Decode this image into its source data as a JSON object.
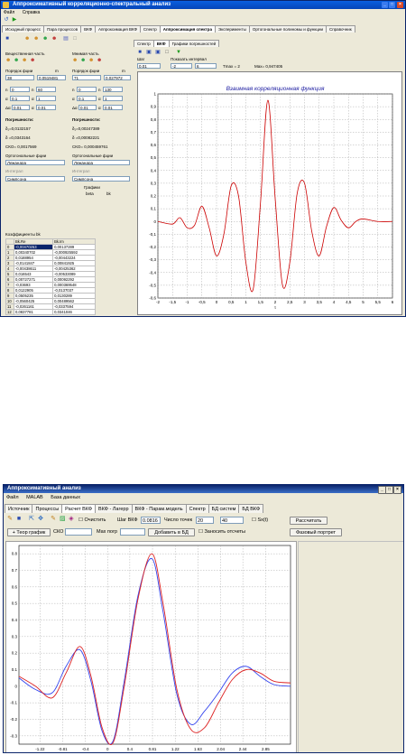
{
  "win1": {
    "title": "Аппроксимативный корреляционно-спектральный анализ",
    "menu": [
      "Файл",
      "Справка"
    ],
    "top_tabs": [
      "Исходный процесс",
      "Пара процессов",
      "ВКФ",
      "Аппроксимация ВКФ",
      "Спектр",
      "Аппроксимация спектра",
      "Эксперименты",
      "Ортогональные полиномы и функции",
      "Справочник"
    ],
    "left": {
      "real_part": "Вещественная часть",
      "imag_part": "Мнимая часть",
      "order_label": "Порядок фции",
      "m_label": "m",
      "order_real": "38",
      "m_real": "0,0519481",
      "order_imag": "71",
      "m_imag": "0,027972",
      "sym_n": "n",
      "sym_a": "α",
      "sym_dalpha": "Δα",
      "sym_alpha": "α",
      "real_n_min": "0",
      "real_n_max": "60",
      "real_a_min": "0,1",
      "real_a_max": "1",
      "real_da": "0,01",
      "real_e": "0,01",
      "imag_n_min": "0",
      "imag_n_max": "130",
      "imag_a_min": "0,1",
      "imag_a_max": "1",
      "imag_da": "0,01",
      "imag_e": "0,01",
      "errors_label": "Погрешности:",
      "real_d1": "δ₁=0,0132157",
      "real_d": "δ =0,0343164",
      "real_sko": "СКО= 0,0017569",
      "imag_d1": "δ₁=0,00247389",
      "imag_d": "δ =0,00082221",
      "imag_sko": "СКО= 0,000459761",
      "orth_label": "Ортогональные фции",
      "orth_value": "Лежандра",
      "integral_label": "Интеграл",
      "method_value": "Симпсона",
      "graphs_label": "Графики",
      "beta_label": "beta",
      "bk_label": "bk",
      "coef_title": "Коэффициенты bk",
      "col1": "Bk.Re",
      "col2": "Bk.Im",
      "rows": [
        [
          "0",
          "-0,00470253",
          "0,00137289"
        ],
        [
          "1",
          "0,00340702",
          "-0,000925592"
        ],
        [
          "2",
          "0,0188954",
          "-0,00443224"
        ],
        [
          "3",
          "-0,0141847",
          "0,00841925"
        ],
        [
          "4",
          "-0,00438611",
          "-0,00425362"
        ],
        [
          "5",
          "0,016543",
          "-0,00533089"
        ],
        [
          "6",
          "0,00727271",
          "0,00092292"
        ],
        [
          "7",
          "-0,03693",
          "0,000369548"
        ],
        [
          "8",
          "0,0122905",
          "-0,0137037"
        ],
        [
          "9",
          "0,0505235",
          "0,0130289"
        ],
        [
          "10",
          "-0,0560425",
          "0,00489562"
        ],
        [
          "11",
          "-0,0261161",
          "-0,0337594"
        ],
        [
          "12",
          "0,0837781",
          "0,0341046"
        ]
      ]
    },
    "right": {
      "tabs": [
        "Спектр",
        "ВКФ",
        "Графики погрешностей"
      ],
      "step_label": "Шаг",
      "step_value": "0,01",
      "interval_label": "Показать интервал",
      "interval_from": "-2",
      "interval_to": "6",
      "tmax": "Tmax = 2",
      "max": "Max= 0,947405",
      "chart_title": "Взаимная корреляционная функция",
      "xlabel": "τ"
    }
  },
  "win2": {
    "title": "Аппроксимативный анализ",
    "menu": [
      "Файл",
      "MALAB",
      "База данных"
    ],
    "tabs": [
      "Источник",
      "Процессы",
      "Расчет ВКФ",
      "ВКФ - Лагерр",
      "ВКФ - Парам.модель",
      "Спектр",
      "БД систем",
      "БД ВКФ"
    ],
    "clear_label": "Очистить",
    "step_label": "Шаг ВКФ",
    "step_value": "0.0816",
    "points_label": "Число точек",
    "points_value": "20",
    "points_value2": "40",
    "sx_label": "Sx(t)",
    "calc_button": "Рассчитать",
    "theory_button": "+ Теор график",
    "sko_label": "СКО",
    "max_err_label": "Max погр",
    "add_db_button": "Добавить в БД",
    "record_label": "Заносить отсчеты",
    "phase_button": "Фазовый портрет"
  },
  "chart_data": [
    {
      "type": "line",
      "title": "Взаимная корреляционная функция",
      "xlabel": "τ",
      "ylabel": "",
      "xlim": [
        -2,
        6
      ],
      "ylim": [
        -0.6,
        1
      ],
      "grid": true,
      "x_ticks": [
        "-2",
        "-1,5",
        "-1",
        "-0,5",
        "0",
        "0,5",
        "1",
        "1,5",
        "2",
        "2,5",
        "3",
        "3,5",
        "4",
        "4,5",
        "5",
        "5,5",
        "6"
      ],
      "y_ticks": [
        "1",
        "0,9",
        "0,8",
        "0,7",
        "0,6",
        "0,5",
        "0,4",
        "0,3",
        "0,2",
        "0,1",
        "0",
        "-0,1",
        "-0,2",
        "-0,3",
        "-0,4",
        "-0,5",
        "-0,6"
      ],
      "series": [
        {
          "color": "#cc0000",
          "x": [
            -2,
            -1.5,
            -1.25,
            -1,
            -0.75,
            -0.5,
            -0.25,
            0,
            0.25,
            0.5,
            0.75,
            1,
            1.25,
            1.5,
            1.75,
            2,
            2.25,
            2.5,
            2.75,
            3,
            3.25,
            3.5,
            3.75,
            4,
            4.25,
            4.5,
            4.75,
            5,
            5.5,
            6
          ],
          "y": [
            0.0,
            -0.02,
            0.03,
            -0.05,
            -0.03,
            0.12,
            -0.05,
            -0.27,
            -0.1,
            0.28,
            0.2,
            -0.32,
            -0.53,
            0.15,
            0.95,
            0.18,
            -0.5,
            -0.32,
            0.22,
            0.3,
            -0.08,
            -0.27,
            -0.04,
            0.11,
            0.01,
            -0.05,
            0.0,
            0.02,
            0.0,
            0.0
          ]
        }
      ]
    },
    {
      "type": "line",
      "title": "",
      "xlabel": "",
      "ylabel": "",
      "xlim": [
        -1.6,
        3.3
      ],
      "ylim": [
        -0.35,
        0.85
      ],
      "grid": true,
      "x_ticks": [
        "-1.22",
        "-0.81",
        "-0.4",
        "0",
        "0.4",
        "0.81",
        "1.22",
        "1.63",
        "2.04",
        "2.44",
        "2.85"
      ],
      "y_ticks": [
        "0.8",
        "0.7",
        "0.6",
        "0.5",
        "0.4",
        "0.3",
        "0.2",
        "0.1",
        "0",
        "-0.1",
        "-0.2",
        "-0.3"
      ],
      "series": [
        {
          "color": "#3344ee",
          "x": [
            -1.6,
            -1.3,
            -1.0,
            -0.75,
            -0.5,
            -0.3,
            -0.1,
            0.1,
            0.3,
            0.55,
            0.8,
            1.0,
            1.25,
            1.5,
            1.75,
            2.0,
            2.25,
            2.5,
            2.75,
            3.0,
            3.3
          ],
          "y": [
            0.05,
            -0.02,
            -0.04,
            0.12,
            0.22,
            0.03,
            -0.27,
            -0.33,
            0.03,
            0.55,
            0.77,
            0.45,
            -0.05,
            -0.23,
            -0.15,
            -0.04,
            0.08,
            0.12,
            0.06,
            0.01,
            0.0
          ]
        },
        {
          "color": "#dd2222",
          "x": [
            -1.6,
            -1.3,
            -1.0,
            -0.75,
            -0.5,
            -0.3,
            -0.1,
            0.1,
            0.3,
            0.55,
            0.8,
            1.0,
            1.25,
            1.5,
            1.75,
            2.0,
            2.25,
            2.5,
            2.75,
            3.0,
            3.3
          ],
          "y": [
            0.06,
            0.0,
            -0.07,
            0.08,
            0.24,
            0.06,
            -0.25,
            -0.34,
            0.0,
            0.53,
            0.8,
            0.5,
            -0.02,
            -0.26,
            -0.25,
            -0.1,
            0.04,
            0.1,
            0.08,
            0.03,
            0.02
          ]
        }
      ]
    }
  ]
}
